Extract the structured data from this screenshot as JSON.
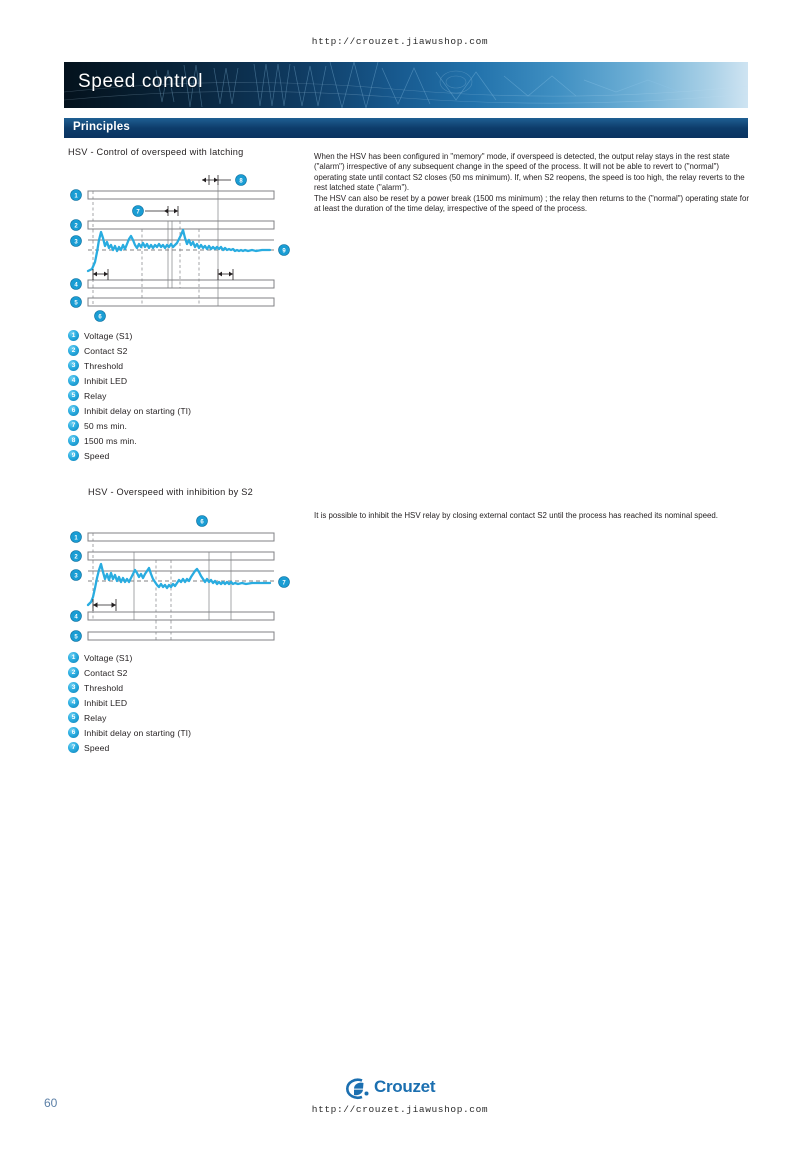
{
  "page": {
    "top_url": "http://crouzet.jiawushop.com",
    "footer_url": "http://crouzet.jiawushop.com",
    "page_number": "60",
    "brand": "Crouzet",
    "accent_blue": "#29ace0",
    "banner_dark": "#04121d",
    "banner_light": "#cfe4f2",
    "bar_color": "#0d3c6b"
  },
  "header": {
    "title": "Speed control",
    "section_bar": "Principles"
  },
  "sections": [
    {
      "title": "HSV - Control of overspeed with latching",
      "paragraph": "When the HSV has been configured in \"memory\" mode, if overspeed is detected, the output relay stays in the rest state (\"alarm\") irrespective of any subsequent change in the speed of the process. It will not be able to revert to (\"normal\") operating state until contact S2 closes (50 ms minimum). If, when S2 reopens, the speed is too high, the relay reverts to the rest latched state (\"alarm\").\nThe HSV can also be reset by a power break (1500 ms minimum) ; the relay then returns to the (\"normal\") operating state for at least the duration of the time delay, irrespective of the speed of the process.",
      "legend": [
        {
          "num": "1",
          "label": "Voltage (S1)"
        },
        {
          "num": "2",
          "label": "Contact S2"
        },
        {
          "num": "3",
          "label": "Threshold"
        },
        {
          "num": "4",
          "label": "Inhibit LED"
        },
        {
          "num": "5",
          "label": "Relay"
        },
        {
          "num": "6",
          "label": "Inhibit delay on starting (TI)"
        },
        {
          "num": "7",
          "label": "50 ms min."
        },
        {
          "num": "8",
          "label": "1500 ms min."
        },
        {
          "num": "9",
          "label": "Speed"
        }
      ],
      "diagram": {
        "tracks": [
          {
            "num": "1",
            "name": "voltage-s1"
          },
          {
            "num": "2",
            "name": "contact-s2"
          },
          {
            "num": "3",
            "name": "threshold"
          },
          {
            "num": "4",
            "name": "inhibit-led"
          },
          {
            "num": "5",
            "name": "relay"
          }
        ],
        "callouts": [
          "6",
          "7",
          "8",
          "9"
        ]
      }
    },
    {
      "title": "HSV - Overspeed with inhibition by S2",
      "paragraph": "It is possible to inhibit the HSV relay by closing external contact S2 until the process has reached its nominal speed.",
      "legend": [
        {
          "num": "1",
          "label": "Voltage (S1)"
        },
        {
          "num": "2",
          "label": "Contact S2"
        },
        {
          "num": "3",
          "label": "Threshold"
        },
        {
          "num": "4",
          "label": "Inhibit LED"
        },
        {
          "num": "5",
          "label": "Relay"
        },
        {
          "num": "6",
          "label": "Inhibit delay on starting (TI)"
        },
        {
          "num": "7",
          "label": "Speed"
        }
      ],
      "diagram": {
        "tracks": [
          {
            "num": "1",
            "name": "voltage-s1"
          },
          {
            "num": "2",
            "name": "contact-s2"
          },
          {
            "num": "3",
            "name": "threshold"
          },
          {
            "num": "4",
            "name": "inhibit-led"
          },
          {
            "num": "5",
            "name": "relay"
          }
        ],
        "callouts": [
          "6",
          "7"
        ]
      }
    }
  ]
}
